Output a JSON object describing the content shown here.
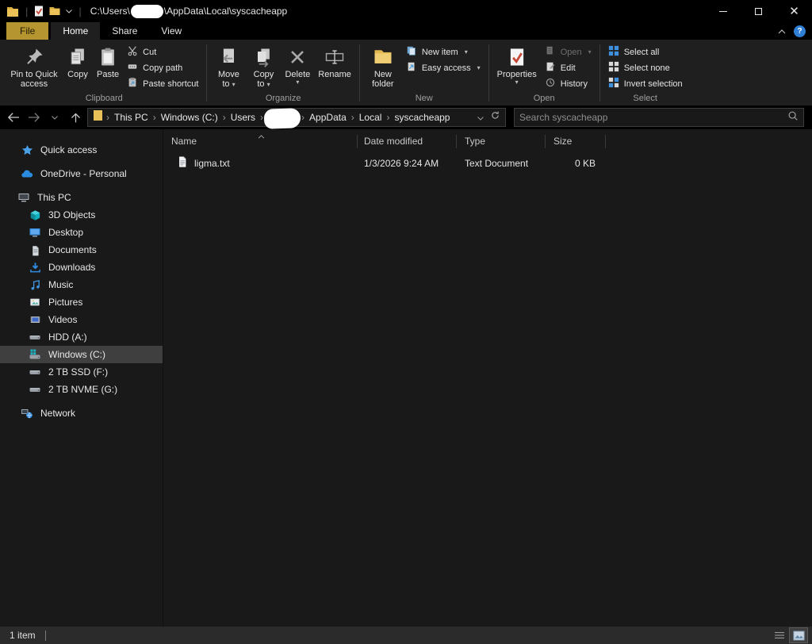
{
  "titlebar": {
    "path_prefix": "C:\\Users\\",
    "path_suffix": "\\AppData\\Local\\syscacheapp"
  },
  "tabs": {
    "file": "File",
    "home": "Home",
    "share": "Share",
    "view": "View"
  },
  "ribbon": {
    "clipboard": {
      "label": "Clipboard",
      "pin_to_quick_access": "Pin to Quick access",
      "copy": "Copy",
      "paste": "Paste",
      "cut": "Cut",
      "copy_path": "Copy path",
      "paste_shortcut": "Paste shortcut"
    },
    "organize": {
      "label": "Organize",
      "move_to": "Move to",
      "copy_to": "Copy to",
      "delete": "Delete",
      "rename": "Rename"
    },
    "new": {
      "label": "New",
      "new_folder": "New folder",
      "new_item": "New item",
      "easy_access": "Easy access"
    },
    "open": {
      "label": "Open",
      "properties": "Properties",
      "open": "Open",
      "edit": "Edit",
      "history": "History"
    },
    "select": {
      "label": "Select",
      "select_all": "Select all",
      "select_none": "Select none",
      "invert_selection": "Invert selection"
    }
  },
  "address": {
    "crumbs": [
      "This PC",
      "Windows (C:)",
      "Users",
      "AppData",
      "Local",
      "syscacheapp"
    ],
    "search_placeholder": "Search syscacheapp"
  },
  "sidebar": {
    "items": [
      {
        "label": "Quick access"
      },
      {
        "label": "OneDrive - Personal"
      },
      {
        "label": "This PC"
      },
      {
        "label": "3D Objects"
      },
      {
        "label": "Desktop"
      },
      {
        "label": "Documents"
      },
      {
        "label": "Downloads"
      },
      {
        "label": "Music"
      },
      {
        "label": "Pictures"
      },
      {
        "label": "Videos"
      },
      {
        "label": "HDD (A:)"
      },
      {
        "label": "Windows (C:)",
        "selected": true
      },
      {
        "label": "2 TB SSD (F:)"
      },
      {
        "label": "2 TB NVME (G:)"
      },
      {
        "label": "Network"
      }
    ]
  },
  "files": {
    "columns": {
      "name": "Name",
      "date_modified": "Date modified",
      "type": "Type",
      "size": "Size"
    },
    "rows": [
      {
        "name": "ligma.txt",
        "date_modified": "1/3/2026 9:24 AM",
        "type": "Text Document",
        "size": "0 KB"
      }
    ]
  },
  "statusbar": {
    "item_count": "1 item"
  },
  "colors": {
    "file_tab_gold": "#b5952f",
    "folder_gold": "#ecc258",
    "accent_blue": "#3f91e0",
    "help_blue": "#2f7fd6",
    "background": "#191919"
  }
}
